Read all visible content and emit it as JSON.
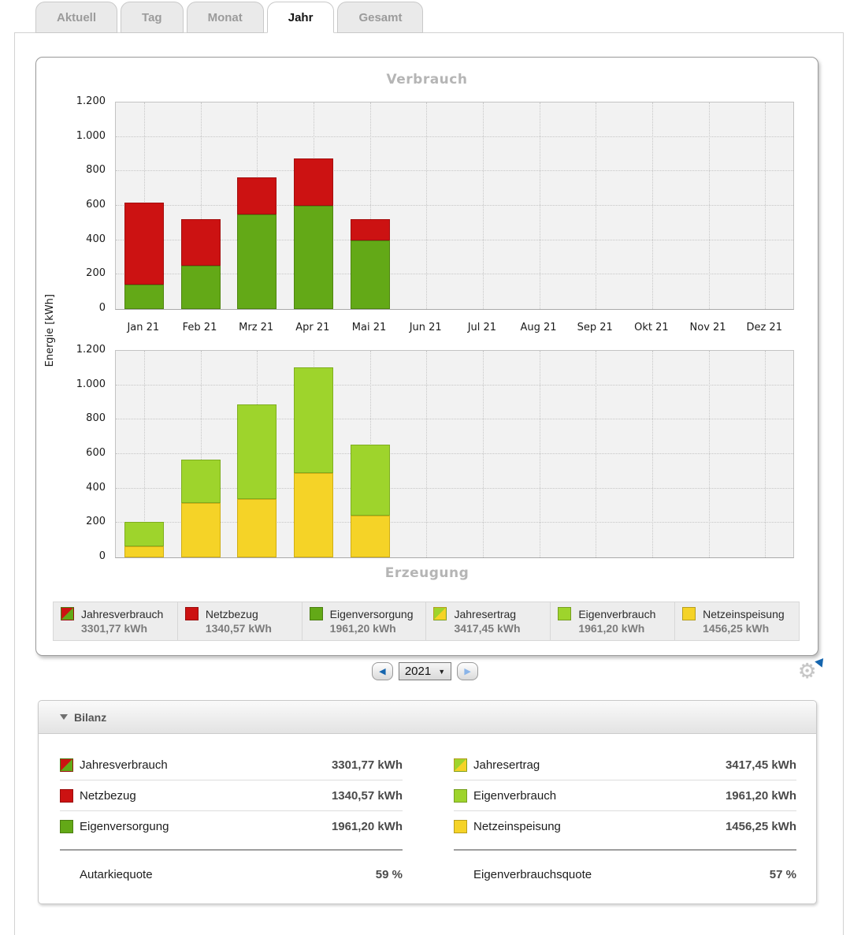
{
  "tabs": [
    {
      "label": "Aktuell",
      "active": false
    },
    {
      "label": "Tag",
      "active": false
    },
    {
      "label": "Monat",
      "active": false
    },
    {
      "label": "Jahr",
      "active": true
    },
    {
      "label": "Gesamt",
      "active": false
    }
  ],
  "colors": {
    "red": "#cc1212",
    "red_border": "#a30e0e",
    "green": "#63a917",
    "green_border": "#4e850f",
    "lightgreen": "#9ed42c",
    "lightgreen_border": "#7fae1f",
    "yellow": "#f5d327",
    "yellow_border": "#cfae14",
    "title_gray": "#b5b5b5",
    "accent_blue": "#1565ae"
  },
  "chart_data": [
    {
      "type": "bar",
      "stacked": true,
      "title": "Verbrauch",
      "categories": [
        "Jan 21",
        "Feb 21",
        "Mrz 21",
        "Apr 21",
        "Mai 21",
        "Jun 21",
        "Jul 21",
        "Aug 21",
        "Sep 21",
        "Okt 21",
        "Nov 21",
        "Dez 21"
      ],
      "series": [
        {
          "name": "Eigenversorgung",
          "color": "#63a917",
          "border_color": "#4e850f",
          "values": [
            140,
            252,
            548,
            602,
            400,
            0,
            0,
            0,
            0,
            0,
            0,
            0
          ]
        },
        {
          "name": "Netzbezug",
          "color": "#cc1212",
          "border_color": "#a30e0e",
          "values": [
            478,
            272,
            218,
            272,
            120,
            0,
            0,
            0,
            0,
            0,
            0,
            0
          ]
        }
      ],
      "ylabel": "Energie [kWh]",
      "ylim": [
        0,
        1200
      ],
      "yticks": [
        {
          "v": 0,
          "label": "0"
        },
        {
          "v": 200,
          "label": "200"
        },
        {
          "v": 400,
          "label": "400"
        },
        {
          "v": 600,
          "label": "600"
        },
        {
          "v": 800,
          "label": "800"
        },
        {
          "v": 1000,
          "label": "1.000"
        },
        {
          "v": 1200,
          "label": "1.200"
        }
      ],
      "grid": true,
      "legend_position": "bottom"
    },
    {
      "type": "bar",
      "stacked": true,
      "title": "Erzeugung",
      "categories": [
        "Jan 21",
        "Feb 21",
        "Mrz 21",
        "Apr 21",
        "Mai 21",
        "Jun 21",
        "Jul 21",
        "Aug 21",
        "Sep 21",
        "Okt 21",
        "Nov 21",
        "Dez 21"
      ],
      "series": [
        {
          "name": "Netzeinspeisung",
          "color": "#f5d327",
          "border_color": "#cfae14",
          "values": [
            62,
            315,
            340,
            490,
            245,
            0,
            0,
            0,
            0,
            0,
            0,
            0
          ]
        },
        {
          "name": "Eigenverbrauch",
          "color": "#9ed42c",
          "border_color": "#7fae1f",
          "values": [
            143,
            255,
            550,
            613,
            410,
            0,
            0,
            0,
            0,
            0,
            0,
            0
          ]
        }
      ],
      "ylabel": "Energie [kWh]",
      "ylim": [
        0,
        1200
      ],
      "yticks": [
        {
          "v": 0,
          "label": "0"
        },
        {
          "v": 200,
          "label": "200"
        },
        {
          "v": 400,
          "label": "400"
        },
        {
          "v": 600,
          "label": "600"
        },
        {
          "v": 800,
          "label": "800"
        },
        {
          "v": 1000,
          "label": "1.000"
        },
        {
          "v": 1200,
          "label": "1.200"
        }
      ],
      "grid": true,
      "legend_position": "bottom"
    }
  ],
  "legend": {
    "items": [
      {
        "label": "Jahresverbrauch",
        "value": "3301,77 kWh",
        "icon": "red-green-diagonal"
      },
      {
        "label": "Netzbezug",
        "value": "1340,57 kWh",
        "icon": "red"
      },
      {
        "label": "Eigenversorgung",
        "value": "1961,20 kWh",
        "icon": "green"
      },
      {
        "label": "Jahresertrag",
        "value": "3417,45 kWh",
        "icon": "lightgreen-yellow-diagonal"
      },
      {
        "label": "Eigenverbrauch",
        "value": "1961,20 kWh",
        "icon": "lightgreen"
      },
      {
        "label": "Netzeinspeisung",
        "value": "1456,25 kWh",
        "icon": "yellow"
      }
    ]
  },
  "year_nav": {
    "selected_year": "2021",
    "prev_icon": "◀",
    "next_icon": "▶",
    "caret": "▼"
  },
  "bilanz": {
    "title": "Bilanz",
    "left_rows": [
      {
        "label": "Jahresverbrauch",
        "value": "3301,77 kWh",
        "icon": "red-green-diagonal"
      },
      {
        "label": "Netzbezug",
        "value": "1340,57 kWh",
        "icon": "red"
      },
      {
        "label": "Eigenversorgung",
        "value": "1961,20 kWh",
        "icon": "green"
      }
    ],
    "right_rows": [
      {
        "label": "Jahresertrag",
        "value": "3417,45 kWh",
        "icon": "lightgreen-yellow-diagonal"
      },
      {
        "label": "Eigenverbrauch",
        "value": "1961,20 kWh",
        "icon": "lightgreen"
      },
      {
        "label": "Netzeinspeisung",
        "value": "1456,25 kWh",
        "icon": "yellow"
      }
    ],
    "left_quote": {
      "label": "Autarkiequote",
      "value": "59 %"
    },
    "right_quote": {
      "label": "Eigenverbrauchsquote",
      "value": "57 %"
    }
  }
}
